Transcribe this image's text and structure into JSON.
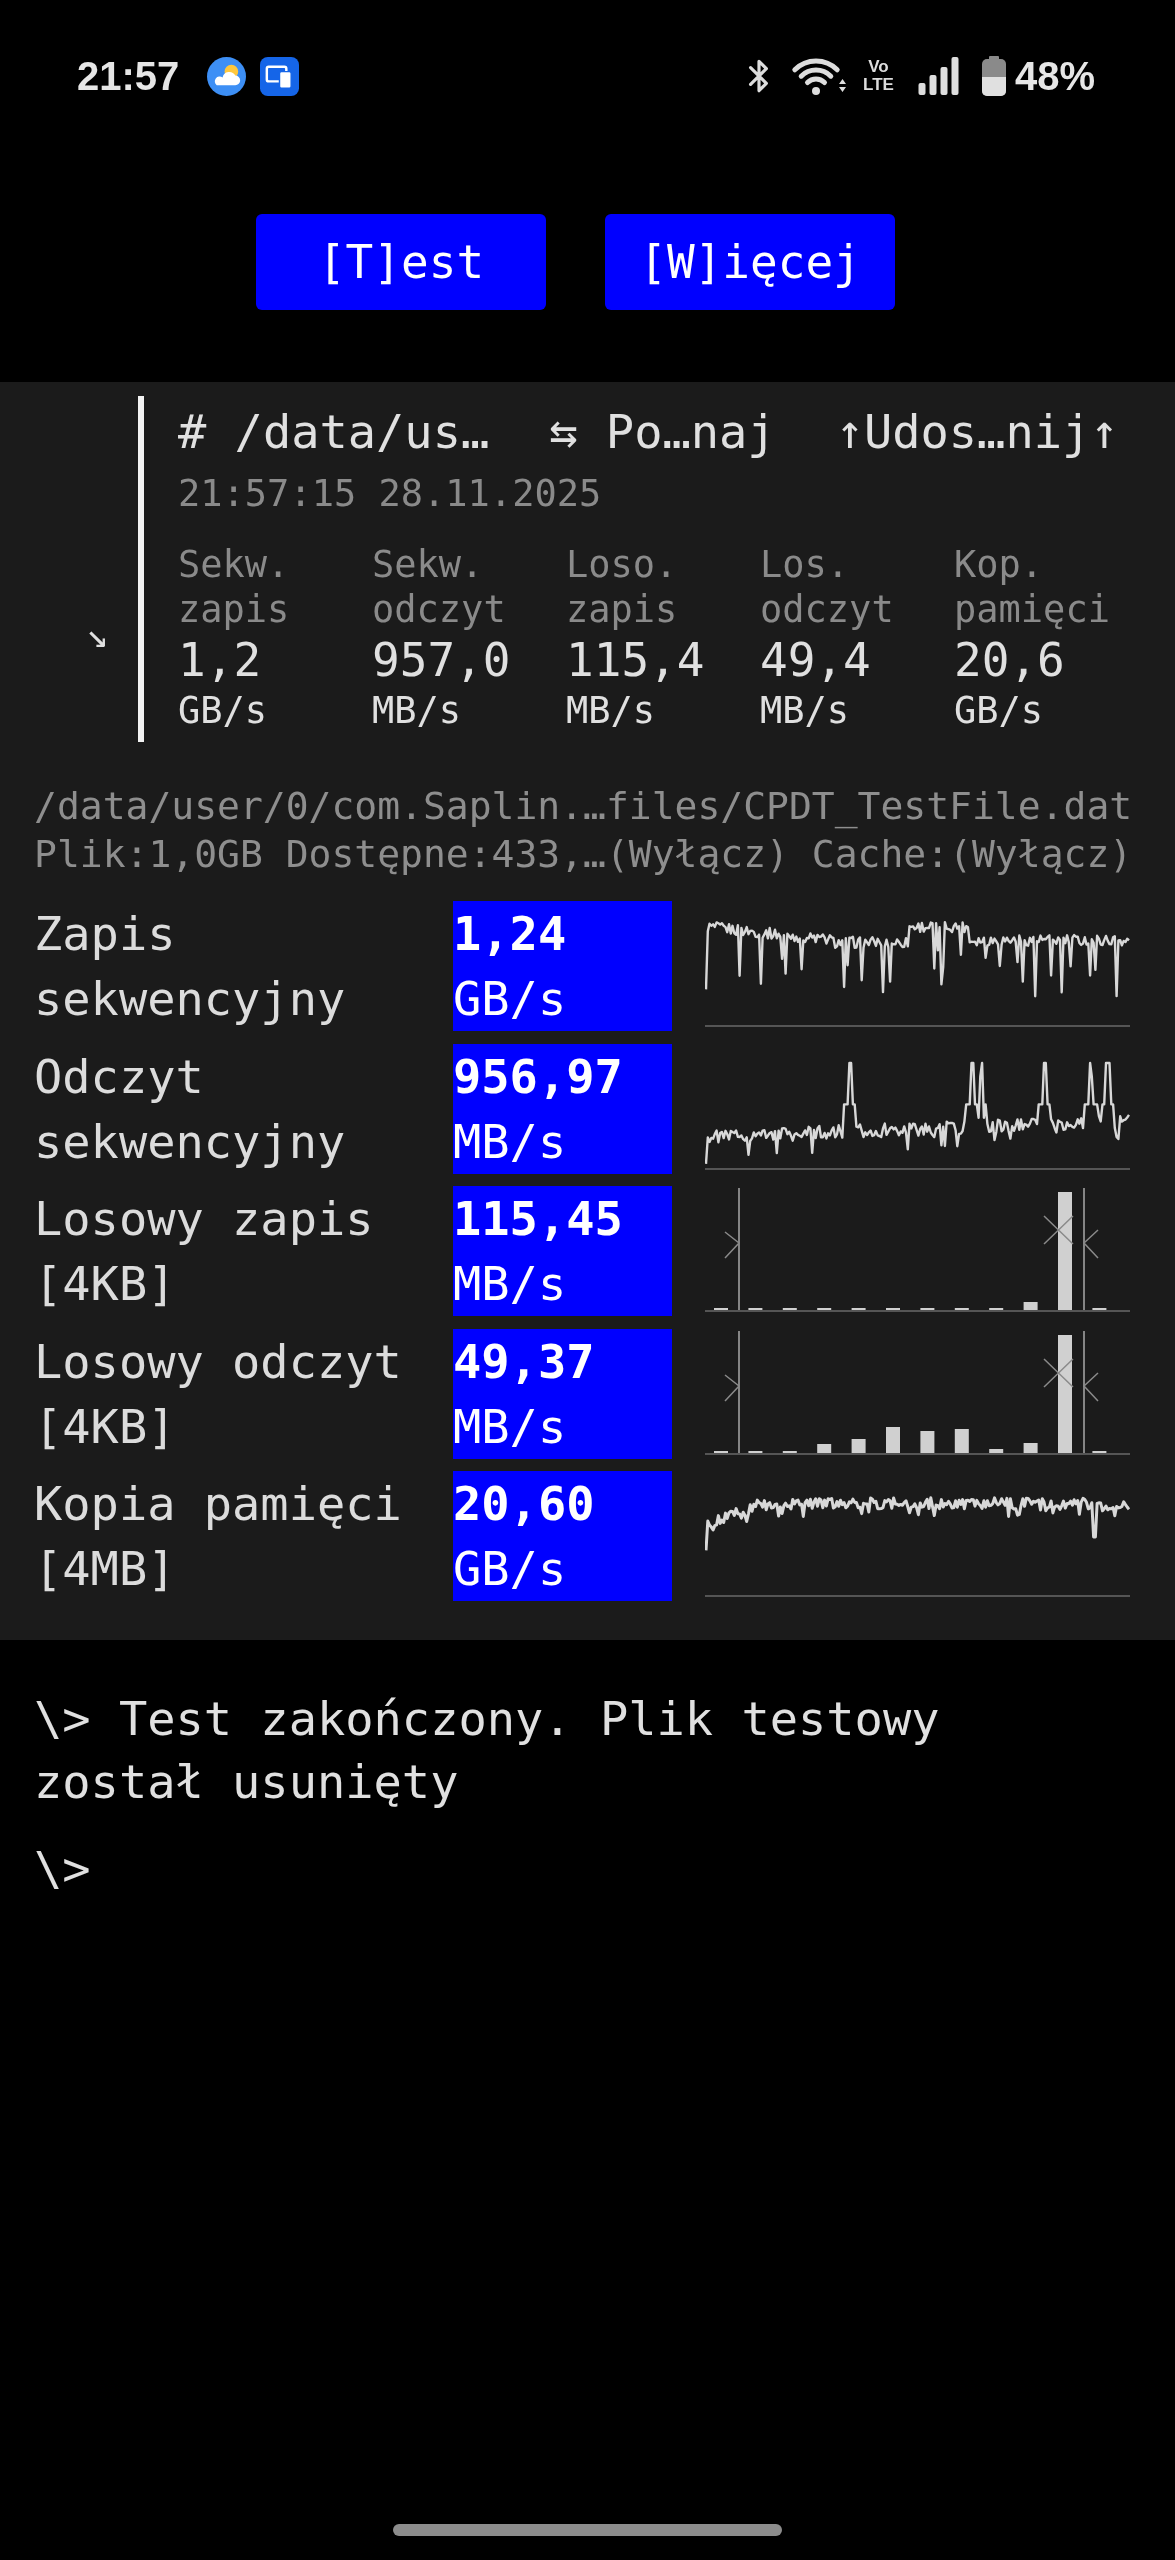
{
  "status_bar": {
    "time": "21:57",
    "network": [
      "Vo",
      "LTE"
    ],
    "battery": "48%"
  },
  "buttons": [
    "[T]est",
    "[W]ięcej"
  ],
  "summary": {
    "toggle": "↘",
    "actions": [
      "# /data/us…",
      "⇆ Po…naj",
      "↑Udos…nij↑"
    ],
    "timestamp": "21:57:15 28.11.2025",
    "stats": [
      {
        "label": "Sekw. zapis",
        "value": "1,2",
        "unit": "GB/s"
      },
      {
        "label": "Sekw. odczyt",
        "value": "957,0",
        "unit": "MB/s"
      },
      {
        "label": "Loso. zapis",
        "value": "115,4",
        "unit": "MB/s"
      },
      {
        "label": "Los. odczyt",
        "value": "49,4",
        "unit": "MB/s"
      },
      {
        "label": "Kop. pamięci",
        "value": "20,6",
        "unit": "GB/s"
      }
    ]
  },
  "file_info": [
    "/data/user/0/com.Saplin.…files/CPDT_TestFile.dat",
    "Plik:1,0GB Dostępne:433,…(Wyłącz) Cache:(Wyłącz)"
  ],
  "results": [
    {
      "label": "Zapis sekwencyjny",
      "value": "1,24",
      "unit": "GB/s",
      "kind": "line"
    },
    {
      "label": "Odczyt sekwencyjny",
      "value": "956,97",
      "unit": "MB/s",
      "kind": "line"
    },
    {
      "label": "Losowy zapis [4KB]",
      "value": "115,45",
      "unit": "MB/s",
      "kind": "bars"
    },
    {
      "label": "Losowy odczyt [4KB]",
      "value": "49,37",
      "unit": "MB/s",
      "kind": "bars"
    },
    {
      "label": "Kopia pamięci [4MB]",
      "value": "20,60",
      "unit": "GB/s",
      "kind": "line"
    }
  ],
  "console": [
    "\\> Test zakończony. Plik testowy został usunięty",
    "\\>"
  ]
}
